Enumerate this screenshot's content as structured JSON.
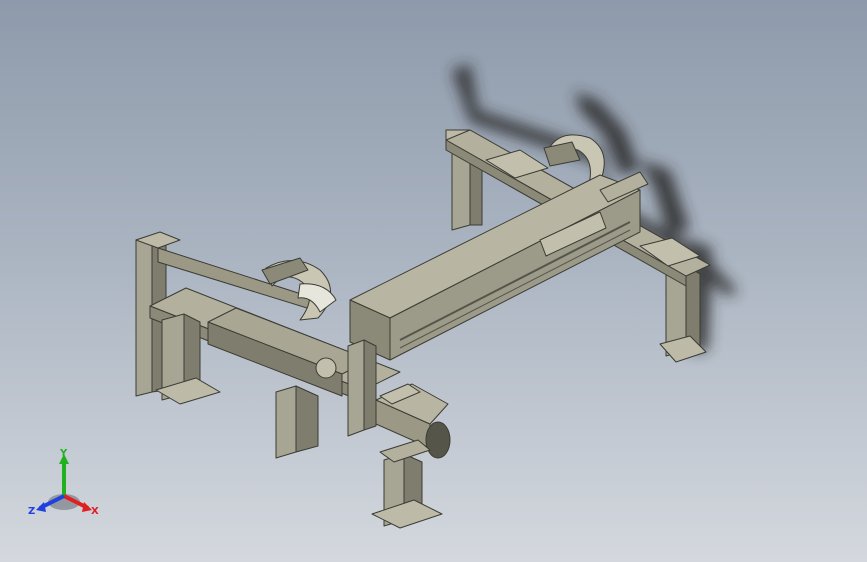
{
  "viewport": {
    "background_top": "#8e9aab",
    "background_bottom": "#d4d8de",
    "model_color": "#9b9886"
  },
  "triad": {
    "x_label": "X",
    "y_label": "Y",
    "z_label": "Z",
    "x_color": "#e02020",
    "y_color": "#20b020",
    "z_color": "#2040e0"
  }
}
